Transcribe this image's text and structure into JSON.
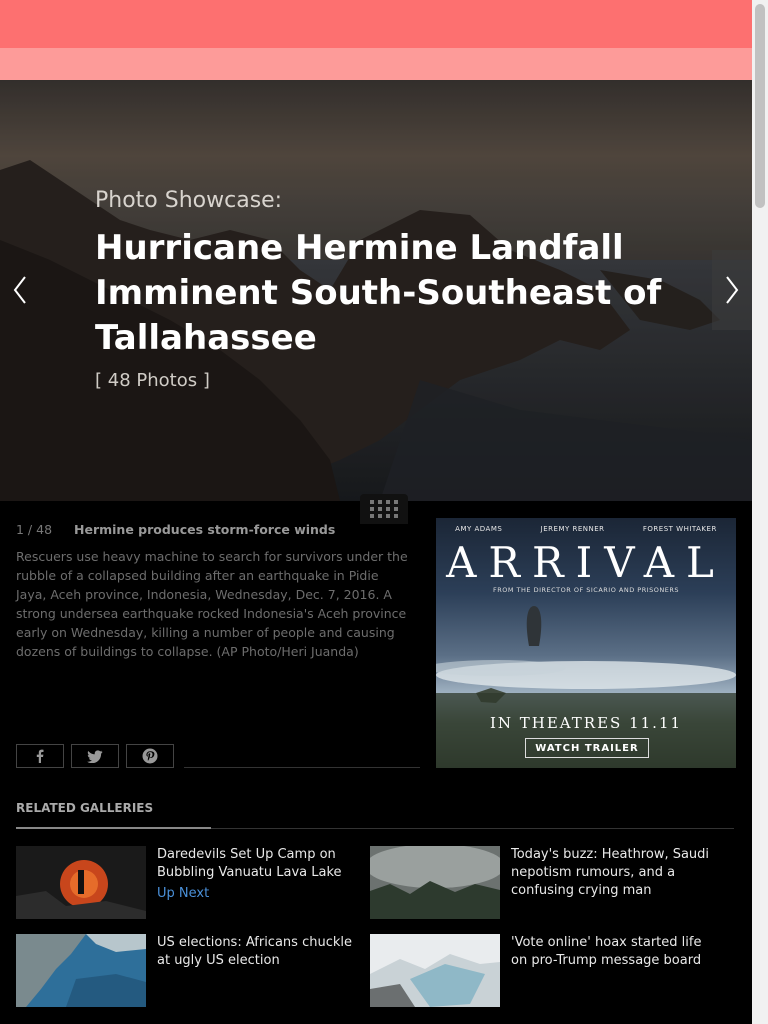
{
  "hero": {
    "kicker": "Photo Showcase:",
    "title": "Hurricane Hermine Landfall Imminent South-Southeast of Tallahassee",
    "count": "[ 48 Photos ]"
  },
  "caption": {
    "index": "1 / 48",
    "headline": "Hermine produces storm-force winds",
    "description": "Rescuers use heavy machine to search for survivors under the rubble of a collapsed building after an earthquake in Pidie Jaya, Aceh province, Indonesia, Wednesday, Dec. 7, 2016. A strong undersea earthquake rocked Indonesia's Aceh province early on Wednesday, killing a number of people and causing dozens of buildings to collapse. (AP Photo/Heri Juanda)"
  },
  "share": {
    "icons": [
      "facebook-icon",
      "twitter-icon",
      "pinterest-icon"
    ]
  },
  "ad": {
    "actors": [
      "AMY ADAMS",
      "JEREMY RENNER",
      "FOREST WHITAKER"
    ],
    "brand": "ARRIVAL",
    "from": "FROM THE DIRECTOR OF SICARIO AND PRISONERS",
    "theatres": "IN THEATRES 11.11",
    "cta": "WATCH TRAILER"
  },
  "related": {
    "title": "RELATED GALLERIES",
    "items": [
      {
        "title": "Daredevils Set Up Camp on Bubbling Vanuatu Lava Lake",
        "badge": "Up Next"
      },
      {
        "title": "Today's buzz: Heathrow, Saudi nepotism rumours, and a confusing crying man"
      },
      {
        "title": "US elections: Africans chuckle at ugly US election"
      },
      {
        "title": "'Vote online' hoax started life on pro-Trump message board"
      }
    ]
  },
  "colors": {
    "top_bar": "#fd7070",
    "second_bar": "#fd9b99",
    "link": "#4a90d9",
    "background": "#000000"
  }
}
